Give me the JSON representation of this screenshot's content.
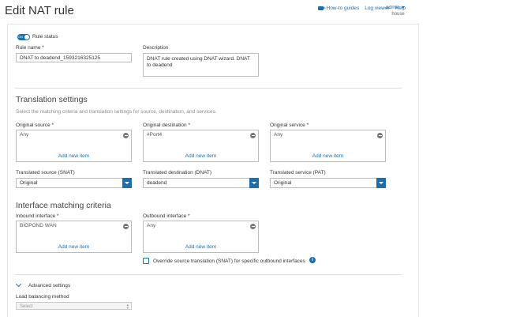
{
  "header": {
    "title": "Edit NAT rule",
    "links": [
      {
        "label": "How-to guides",
        "icon": "video-icon"
      },
      {
        "label": "Log viewer"
      },
      {
        "label": "Help"
      }
    ],
    "user": {
      "name": "admin",
      "org": "house"
    }
  },
  "rule": {
    "status_label": "Rule status",
    "toggle_text": "ON",
    "name_label": "Rule name *",
    "name_value": "DNAT to deadend_1593216325125",
    "description_label": "Description",
    "description_value": "DNAT rule created using DNAT wizard. DNAT to deadend"
  },
  "translation": {
    "title": "Translation settings",
    "subtitle": "Select the matching criteria and translation settings for source, destination, and services.",
    "original_source": {
      "label": "Original source *",
      "value": "Any",
      "add_label": "Add new item"
    },
    "original_destination": {
      "label": "Original destination *",
      "value": "#Port4",
      "add_label": "Add new item"
    },
    "original_service": {
      "label": "Original service *",
      "value": "Any",
      "add_label": "Add new item"
    },
    "translated_source": {
      "label": "Translated source (SNAT)",
      "value": "Original"
    },
    "translated_destination": {
      "label": "Translated destination (DNAT)",
      "value": "deadend"
    },
    "translated_service": {
      "label": "Translated service (PAT)",
      "value": "Original"
    }
  },
  "interface": {
    "title": "Interface matching criteria",
    "inbound": {
      "label": "Inbound interface *",
      "value": "BIGPOND WAN",
      "add_label": "Add new item"
    },
    "outbound": {
      "label": "Outbound interface *",
      "value": "Any",
      "add_label": "Add new item"
    },
    "override_label": "Override source translation (SNAT) for specific outbound interfaces",
    "info_glyph": "i"
  },
  "advanced": {
    "label": "Advanced settings",
    "load_balancing_label": "Load balancing method",
    "load_balancing_value": "Select"
  },
  "colors": {
    "accent": "#1a6fb0",
    "border": "#bbbbbb"
  }
}
